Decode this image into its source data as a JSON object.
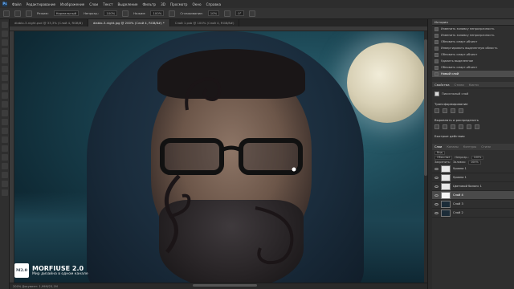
{
  "menu": {
    "logo": "Ps",
    "items": [
      "Файл",
      "Редактирование",
      "Изображение",
      "Слои",
      "Текст",
      "Выделение",
      "Фильтр",
      "3D",
      "Просмотр",
      "Окно",
      "Справка"
    ]
  },
  "options": {
    "mode_label": "Режим:",
    "mode_value": "Нормальный",
    "opacity_label": "Непрозр.:",
    "opacity_value": "100%",
    "pressure_label": "Нажим:",
    "pressure_value": "100%",
    "smoothing_label": "Сглаживание:",
    "smoothing_value": "10%",
    "angle_value": "0°"
  },
  "tabs": [
    "diablo-3-night.psd @ 33,3% (Слой 4, RGB/8)",
    "diablo-3-night.jpg @ 200% (Слой 4, RGB/8#) *",
    "Слой 1.psb @ 100% (Слой 4, RGB/8#)"
  ],
  "status": {
    "text": "200%     Документ: 1,99М/23,1М"
  },
  "watermark": {
    "logo": "M2.0",
    "name": "MORFIUSE 2.0",
    "subtitle": "Мир дизайна в одном канале"
  },
  "history": {
    "title": "История",
    "items": [
      "Изменить заливку непрозрачность",
      "Изменить заливку непрозрачность",
      "Обновить смарт-объект",
      "Инвертировать выделенную область",
      "Обновить смарт-объект",
      "Удалить выделенное",
      "Обновить смарт-объект",
      "Новый слой"
    ],
    "selected_index": 7
  },
  "properties": {
    "tabs": [
      "Свойства",
      "Стили",
      "Кисти"
    ],
    "layer_type": "Пиксельный слой",
    "transform_title": "Трансформирование",
    "align_title": "Выровнять и распределить",
    "quick_actions_title": "Быстрые действия"
  },
  "layers": {
    "tabs": [
      "Слои",
      "Каналы",
      "Контуры",
      "Стили"
    ],
    "kind_label": "Вид",
    "blend": "Обычные",
    "opacity_label": "Непрозр.:",
    "opacity_value": "100%",
    "lock_label": "Закрепить:",
    "fill_label": "Заливка:",
    "fill_value": "100%",
    "items": [
      {
        "name": "Уровни 1",
        "thumb": "white"
      },
      {
        "name": "Уровни 1",
        "thumb": "white"
      },
      {
        "name": "Цветовой баланс 1",
        "thumb": "white"
      },
      {
        "name": "Слой 4",
        "thumb": "mask"
      },
      {
        "name": "Слой 3",
        "thumb": "dark"
      },
      {
        "name": "Слой 2",
        "thumb": "dark"
      }
    ],
    "selected_index": 3
  }
}
